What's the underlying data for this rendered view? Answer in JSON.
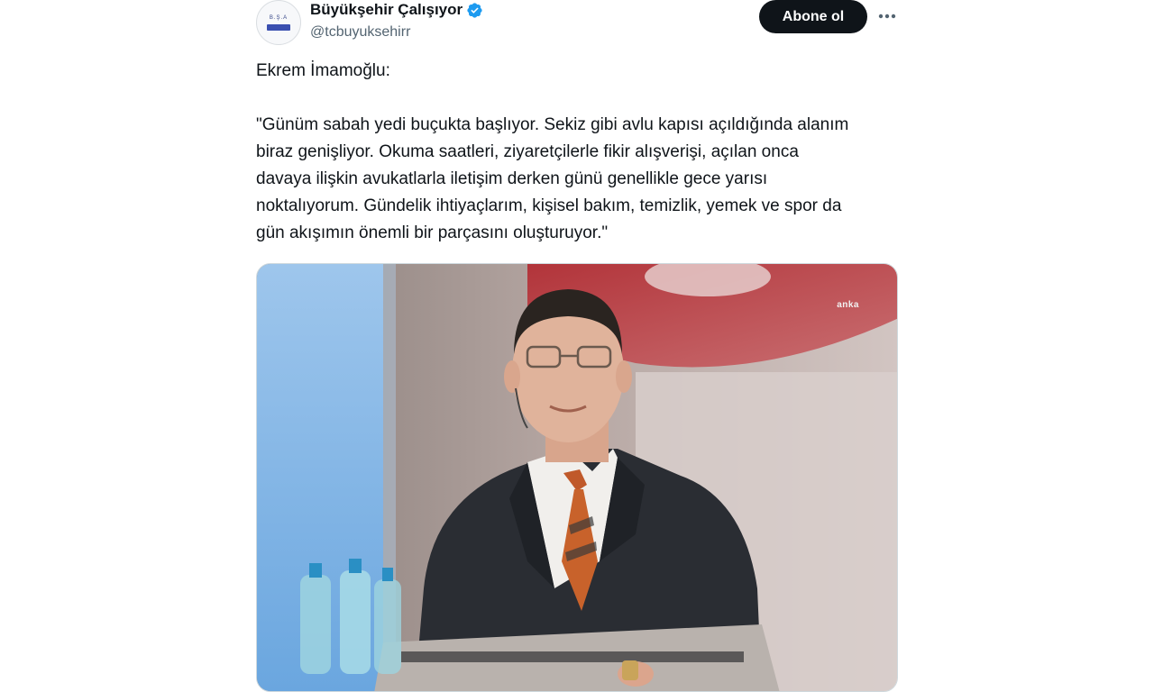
{
  "account": {
    "display_name": "Büyükşehir Çalışıyor",
    "handle": "@tcbuyuksehirr",
    "verified": true,
    "avatar": {
      "icon": "organization-logo-icon"
    }
  },
  "actions": {
    "follow_label": "Abone ol",
    "more_icon": "more-horizontal-icon"
  },
  "tweet": {
    "intro": "Ekrem İmamoğlu:",
    "quote": "\"Günüm sabah yedi buçukta başlıyor. Sekiz gibi avlu kapısı açıldığında alanım\nbiraz genişliyor. Okuma saatleri, ziyaretçilerle fikir alışverişi, açılan onca\ndavaya ilişkin avukatlarla iletişim derken günü genellikle gece yarısı\nnoktalıyorum. Gündelik ihtiyaçlarım, kişisel bakım, temizlik, yemek ve spor da\ngün akışımın önemli bir parçasını oluşturuyor.\""
  },
  "media": {
    "type": "photo",
    "watermark": "anka"
  },
  "colors": {
    "text_primary": "#0f1419",
    "text_secondary": "#536471",
    "verified_blue": "#1d9bf0",
    "button_bg": "#0f1419",
    "button_text": "#ffffff"
  }
}
